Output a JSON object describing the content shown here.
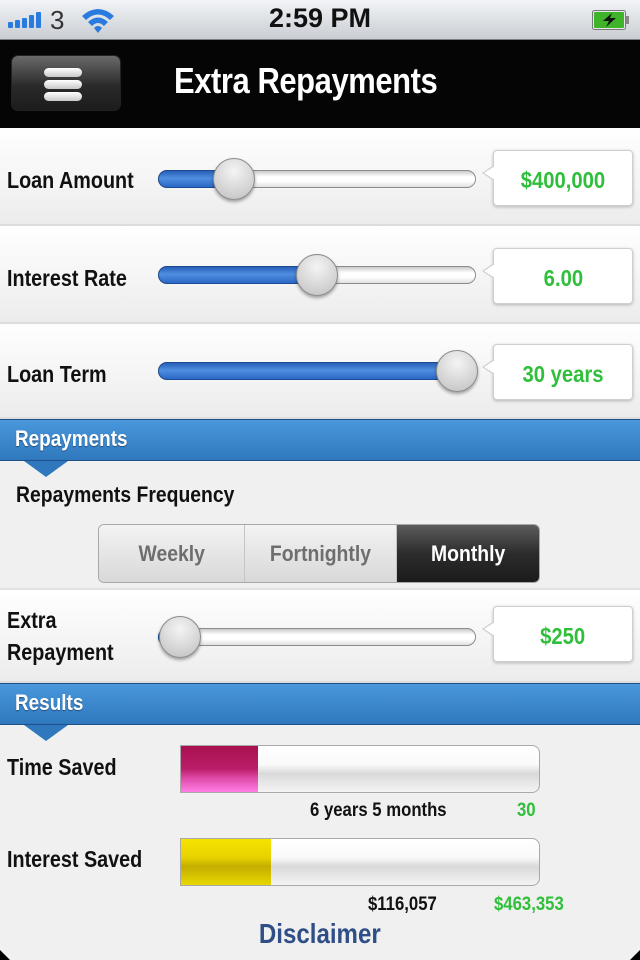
{
  "status_bar": {
    "carrier": "3",
    "time": "2:59 PM",
    "signal_bars": 5,
    "icons": [
      "signal-icon",
      "wifi-icon",
      "battery-charging-icon"
    ]
  },
  "nav": {
    "title": "Extra Repayments",
    "menu_icon": "menu-icon"
  },
  "inputs": [
    {
      "label": "Loan Amount",
      "value": "$400,000",
      "slider_fraction": 0.24
    },
    {
      "label": "Interest Rate",
      "value": "6.00",
      "slider_fraction": 0.5
    },
    {
      "label": "Loan Term",
      "value": "30 years",
      "slider_fraction": 0.94
    }
  ],
  "repayments": {
    "section_title": "Repayments",
    "frequency_label": "Repayments Frequency",
    "frequency_options": [
      "Weekly",
      "Fortnightly",
      "Monthly"
    ],
    "selected_frequency": "Monthly",
    "extra": {
      "label_line1": "Extra",
      "label_line2": "Repayment",
      "value": "$250",
      "slider_fraction": 0.07
    }
  },
  "results": {
    "section_title": "Results",
    "time_saved": {
      "label": "Time Saved",
      "value": "6 years 5 months",
      "max": "30",
      "fraction": 0.214
    },
    "interest_saved": {
      "label": "Interest Saved",
      "value": "$116,057",
      "max": "$463,353",
      "fraction": 0.25
    },
    "disclaimer_label": "Disclaimer"
  },
  "colors": {
    "accent_blue": "#3585cd",
    "value_green": "#2fbf3a",
    "time_bar": "#c01a6e",
    "interest_bar": "#e8d200",
    "disclaimer": "#2f4e86"
  }
}
